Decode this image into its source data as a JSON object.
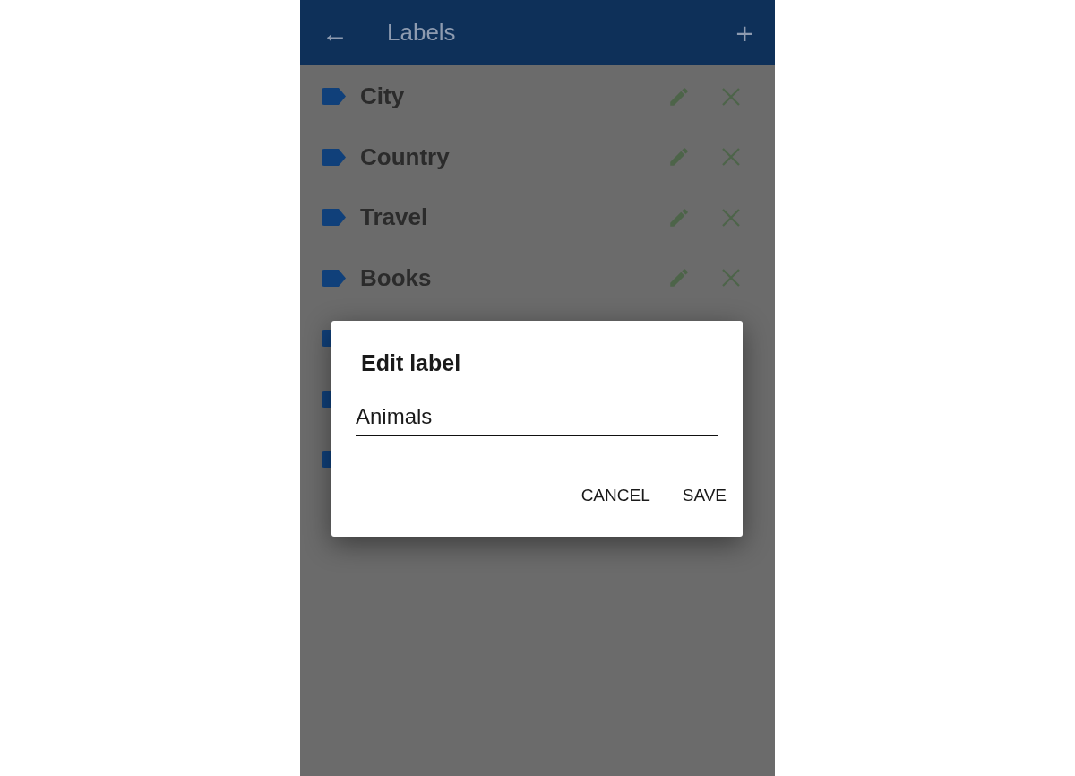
{
  "app_bar": {
    "back": "←",
    "title": "Labels",
    "add": "+"
  },
  "labels": [
    {
      "kind": "named",
      "name": "City"
    },
    {
      "kind": "named",
      "name": "Country"
    },
    {
      "kind": "named",
      "name": "Travel"
    },
    {
      "kind": "named",
      "name": "Books"
    },
    {
      "kind": "covered"
    },
    {
      "kind": "covered"
    },
    {
      "kind": "covered"
    }
  ],
  "dialog": {
    "title": "Edit label",
    "value": "Animals",
    "buttons": [
      "CANCEL",
      "SAVE"
    ]
  }
}
